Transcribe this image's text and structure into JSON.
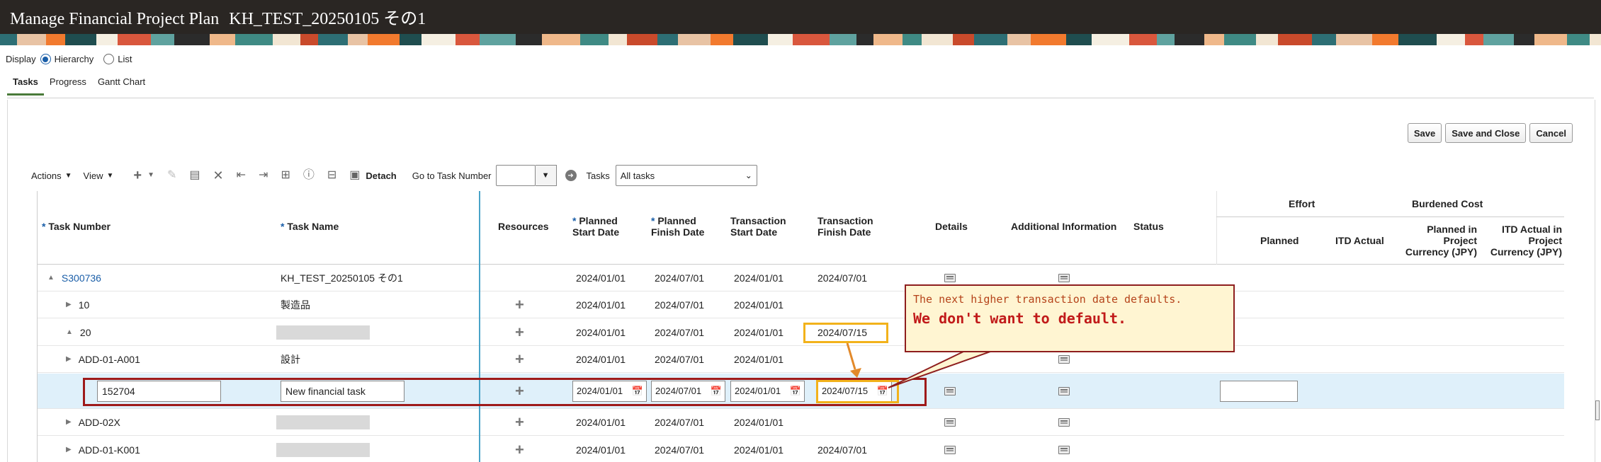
{
  "header": {
    "title": "Manage Financial Project Plan",
    "project": "KH_TEST_20250105 その1",
    "pattern_colors": [
      "#2d6e74",
      "#e8c3a4",
      "#f27a2e",
      "#1f4d4f",
      "#f5efe2",
      "#d9573d",
      "#5fa29f",
      "#2b2b2b",
      "#efb88a",
      "#3f8a84",
      "#f2e6d3",
      "#c94a2b"
    ]
  },
  "display": {
    "label": "Display",
    "options": [
      "Hierarchy",
      "List"
    ],
    "selected": "Hierarchy"
  },
  "tabs": [
    {
      "label": "Tasks",
      "active": true
    },
    {
      "label": "Progress",
      "active": false
    },
    {
      "label": "Gantt Chart",
      "active": false
    }
  ],
  "buttons": {
    "save": "Save",
    "save_close": "Save and Close",
    "cancel": "Cancel"
  },
  "toolbar": {
    "actions": "Actions",
    "view": "View",
    "detach": "Detach",
    "goto_label": "Go to Task Number",
    "tasks_label": "Tasks",
    "tasks_filter": "All tasks"
  },
  "columns": {
    "task_number": "Task Number",
    "task_name": "Task Name",
    "resources": "Resources",
    "planned_start": [
      "Planned",
      "Start Date"
    ],
    "planned_finish": [
      "Planned",
      "Finish Date"
    ],
    "trx_start": [
      "Transaction",
      "Start Date"
    ],
    "trx_finish": [
      "Transaction",
      "Finish Date"
    ],
    "details": "Details",
    "additional": "Additional Information",
    "status": "Status",
    "effort_group": "Effort",
    "effort_planned": "Planned",
    "effort_itd": "ITD Actual",
    "cost_group": "Burdened Cost",
    "cost_planned": [
      "Planned in",
      "Project",
      "Currency (JPY)"
    ],
    "cost_itd": [
      "ITD Actual in",
      "Project",
      "Currency (JPY)"
    ]
  },
  "rows": [
    {
      "number": "S300736",
      "name": "KH_TEST_20250105 その1",
      "ps": "2024/01/01",
      "pf": "2024/07/01",
      "ts": "2024/01/01",
      "tf": "2024/07/01",
      "level": 0,
      "expander": "▲",
      "plus": false,
      "details": true,
      "additional": true
    },
    {
      "number": "10",
      "name": "製造品",
      "ps": "2024/01/01",
      "pf": "2024/07/01",
      "ts": "2024/01/01",
      "tf": "",
      "level": 1,
      "expander": "▶",
      "plus": true,
      "details": false,
      "additional": false
    },
    {
      "number": "20",
      "name": "",
      "ps": "2024/01/01",
      "pf": "2024/07/01",
      "ts": "2024/01/01",
      "tf": "2024/07/15",
      "level": 1,
      "expander": "▲",
      "plus": true,
      "details": false,
      "additional": false
    },
    {
      "number": "ADD-01-A001",
      "name": "設計",
      "ps": "2024/01/01",
      "pf": "2024/07/01",
      "ts": "2024/01/01",
      "tf": "",
      "level": 2,
      "expander": "▶",
      "plus": true,
      "details": false,
      "additional": true
    },
    {
      "number": "152704",
      "name": "New financial task",
      "ps": "2024/01/01",
      "pf": "2024/07/01",
      "ts": "2024/01/01",
      "tf": "2024/07/15",
      "level": 3,
      "editable": true,
      "plus": true,
      "details": true,
      "additional": true
    },
    {
      "number": "ADD-02X",
      "name": "",
      "ps": "2024/01/01",
      "pf": "2024/07/01",
      "ts": "2024/01/01",
      "tf": "",
      "level": 2,
      "expander": "▶",
      "plus": true,
      "details": true,
      "additional": true
    },
    {
      "number": "ADD-01-K001",
      "name": "",
      "ps": "2024/01/01",
      "pf": "2024/07/01",
      "ts": "2024/01/01",
      "tf": "2024/07/01",
      "level": 2,
      "expander": "▶",
      "plus": true,
      "details": true,
      "additional": true
    }
  ],
  "callout": {
    "line1": "The next higher transaction date defaults.",
    "line2": "We don't want to default."
  }
}
